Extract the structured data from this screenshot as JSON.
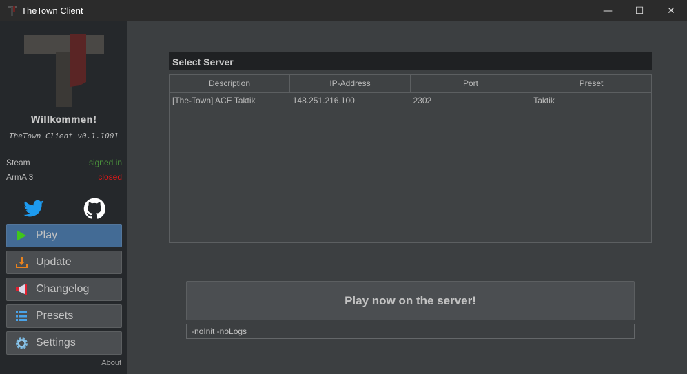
{
  "window": {
    "title": "TheTown Client",
    "minimize": "—",
    "maximize": "☐",
    "close": "✕"
  },
  "sidebar": {
    "welcome": "Willkommen!",
    "version": "TheTown Client v0.1.1001",
    "status": [
      {
        "label": "Steam",
        "value": "signed in",
        "color": "#4e9a3e"
      },
      {
        "label": "ArmA 3",
        "value": "closed",
        "color": "#e01818"
      }
    ],
    "nav": [
      {
        "label": "Play",
        "icon": "play-icon"
      },
      {
        "label": "Update",
        "icon": "download-icon"
      },
      {
        "label": "Changelog",
        "icon": "megaphone-icon"
      },
      {
        "label": "Presets",
        "icon": "list-icon"
      },
      {
        "label": "Settings",
        "icon": "gear-icon"
      }
    ],
    "about": "About"
  },
  "main": {
    "panel_title": "Select Server",
    "columns": [
      "Description",
      "IP-Address",
      "Port",
      "Preset"
    ],
    "rows": [
      [
        "[The-Town] ACE Taktik",
        "148.251.216.100",
        "2302",
        "Taktik"
      ]
    ],
    "play_button": "Play now on the server!",
    "launch_args": "-noInit -noLogs"
  }
}
